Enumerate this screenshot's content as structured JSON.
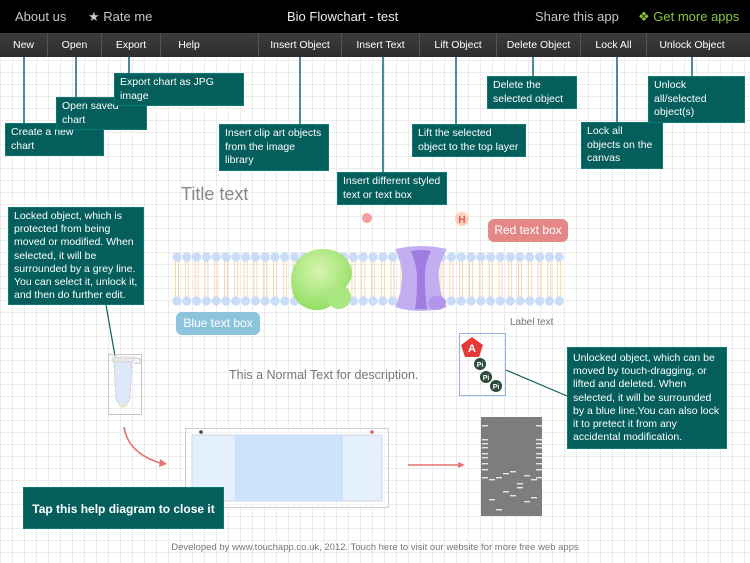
{
  "topbar": {
    "about": "About us",
    "rate": "★ Rate me",
    "title": "Bio Flowchart - test",
    "share": "Share this app",
    "more_icon": "❖",
    "more": "Get more apps"
  },
  "toolbar": {
    "items": [
      "New",
      "Open",
      "Export",
      "Help",
      "Insert Object",
      "Insert Text",
      "Lift Object",
      "Delete Object",
      "Lock All",
      "Unlock Object"
    ]
  },
  "help": {
    "new": "Create a new chart",
    "open": "Open saved chart",
    "export": "Export chart as JPG image",
    "insert_object": "Insert clip art objects from the image library",
    "insert_text": "Insert different styled text or text box",
    "lift": "Lift the selected object to the top layer",
    "delete": "Delete the selected object",
    "lock_all": "Lock all objects on the canvas",
    "unlock": "Unlock all/selected object(s)",
    "locked": "Locked object, which is protected from being moved or modified. When selected, it will be surrounded by a grey line. You can select it, unlock it, and then do further edit.",
    "unlocked": "Unlocked object, which can be moved by touch-dragging, or lifted and deleted. When selected, it will be surrounded by a blue line.You can also lock it to pretect it from any accidental modification.",
    "close": "Tap this help diagram to close it"
  },
  "canvas": {
    "title_text": "Title text",
    "red_box": "Red text box",
    "blue_box": "Blue text box",
    "label_text": "Label text",
    "normal_text": "This a Normal Text for description.",
    "h_label": "H",
    "atp_a": "A",
    "pi": "Pi"
  },
  "colors": {
    "callout": "#045e5c",
    "accent_green": "#8cc63e",
    "red_box": "#e38787",
    "blue_box": "#8cc4dd"
  },
  "footer": "Developed by www.touchapp.co.uk, 2012. Touch here to visit our website for more free web apps"
}
